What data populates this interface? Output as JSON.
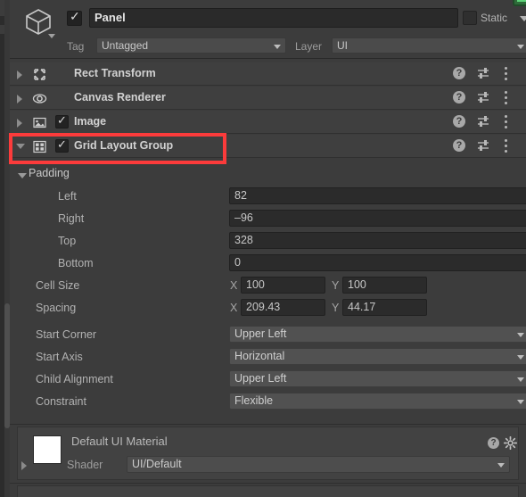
{
  "window": {
    "accent_red": "#fc3b3b",
    "background": "#3c3c3c"
  },
  "gameobject_header": {
    "icon": "cube-icon",
    "enabled_checkbox": "✓",
    "name_value": "Panel",
    "static_label": "Static",
    "static_checked": false,
    "tag_label": "Tag",
    "tag_value": "Untagged",
    "layer_label": "Layer",
    "layer_value": "UI"
  },
  "components": [
    {
      "name": "Rect Transform",
      "icon": "rect-transform-icon",
      "expanded": false,
      "has_checkbox": false,
      "checked": false
    },
    {
      "name": "Canvas Renderer",
      "icon": "eye-icon",
      "expanded": false,
      "has_checkbox": false,
      "checked": false
    },
    {
      "name": "Image",
      "icon": "image-icon",
      "expanded": false,
      "has_checkbox": true,
      "checked": true
    },
    {
      "name": "Grid Layout Group",
      "icon": "grid-layout-icon",
      "expanded": true,
      "has_checkbox": true,
      "checked": true,
      "highlighted": true
    }
  ],
  "row_icons": {
    "help": "?",
    "preset": "preset-icon",
    "menu": "kebab-menu-icon"
  },
  "grid_layout_group": {
    "padding": {
      "title": "Padding",
      "expanded": true,
      "fields": [
        {
          "label": "Left",
          "value": "82"
        },
        {
          "label": "Right",
          "value": "–96"
        },
        {
          "label": "Top",
          "value": "328"
        },
        {
          "label": "Bottom",
          "value": "0"
        }
      ]
    },
    "vector_fields": [
      {
        "label": "Cell Size",
        "x_axis": "X",
        "x_value": "100",
        "y_axis": "Y",
        "y_value": "100"
      },
      {
        "label": "Spacing",
        "x_axis": "X",
        "x_value": "209.43",
        "y_axis": "Y",
        "y_value": "44.17"
      }
    ],
    "dropdowns": [
      {
        "label": "Start Corner",
        "value": "Upper Left"
      },
      {
        "label": "Start Axis",
        "value": "Horizontal"
      },
      {
        "label": "Child Alignment",
        "value": "Upper Left"
      },
      {
        "label": "Constraint",
        "value": "Flexible"
      }
    ]
  },
  "material": {
    "name": "Default UI Material",
    "swatch_color": "#ffffff",
    "shader_label": "Shader",
    "shader_value": "UI/Default",
    "help": "?",
    "gear": "gear-icon"
  }
}
